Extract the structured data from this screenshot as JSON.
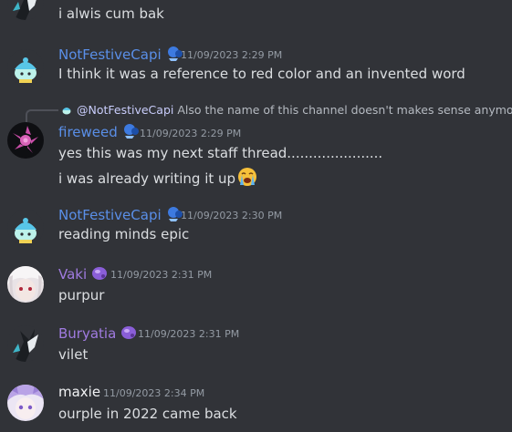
{
  "colors": {
    "background": "#313338",
    "blue_name": "#5a8fe8",
    "purple_name": "#a07be0",
    "white_name": "#f2f3f5",
    "timestamp": "#949ba4"
  },
  "messages": [
    {
      "text": "i alwis cum bak"
    },
    {
      "author": "NotFestiveCapi",
      "timestamp": "11/09/2023 2:29 PM",
      "text": "I think it was a reference to red color and an invented word"
    },
    {
      "reply_mention": "@NotFestiveCapi",
      "reply_text": "Also the name of this channel doesn't makes sense anymore",
      "author": "fireweed",
      "timestamp": "11/09/2023 2:29 PM",
      "text": "yes this was my next staff thread......................",
      "text2": "i was already writing it up",
      "emoji": "loudly-crying-face"
    },
    {
      "author": "NotFestiveCapi",
      "timestamp": "11/09/2023 2:30 PM",
      "text": "reading minds epic"
    },
    {
      "author": "Vaki",
      "timestamp": "11/09/2023 2:31 PM",
      "text": "purpur"
    },
    {
      "author": "Buryatia",
      "timestamp": "11/09/2023 2:31 PM",
      "text": "vilet"
    },
    {
      "author": "maxie",
      "timestamp": "11/09/2023 2:34 PM",
      "text": "ourple in 2022 came back"
    }
  ]
}
